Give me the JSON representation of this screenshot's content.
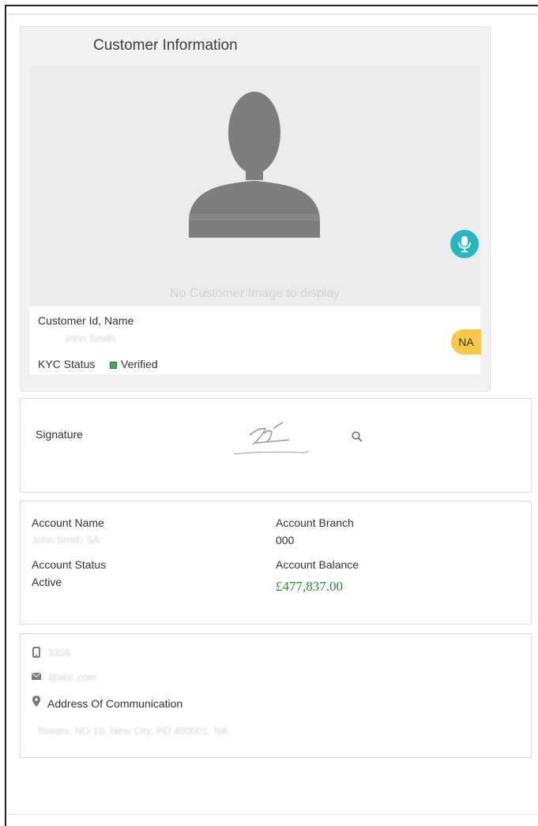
{
  "customer_info": {
    "title": "Customer Information",
    "no_image_text": "No Customer Image to display",
    "customer_id_label": "Customer Id, Name",
    "customer_name_blurred": "John Smith",
    "badge": "NA",
    "kyc_label": "KYC Status",
    "kyc_value": "Verified",
    "mic_icon": "microphone-icon"
  },
  "signature": {
    "label": "Signature",
    "search_icon": "search-icon"
  },
  "account": {
    "name_label": "Account Name",
    "name_value_blurred": "John Smith SA",
    "branch_label": "Account Branch",
    "branch_value": "000",
    "status_label": "Account Status",
    "status_value": "Active",
    "balance_label": "Account Balance",
    "balance_value": "£477,837.00",
    "balance_color": "#2e8b3a"
  },
  "contact": {
    "phone_icon": "mobile-phone-icon",
    "phone_blurred": "3356",
    "email_icon": "envelope-icon",
    "email_blurred": "@abc.com",
    "address_icon": "map-pin-icon",
    "address_label": "Address Of Communication",
    "address_blurred": "Towers, NO 10, New City, PO 400001, NA"
  },
  "colors": {
    "badge": "#f7c84a",
    "mic": "#27b7bd",
    "verified": "#4aa85a"
  }
}
